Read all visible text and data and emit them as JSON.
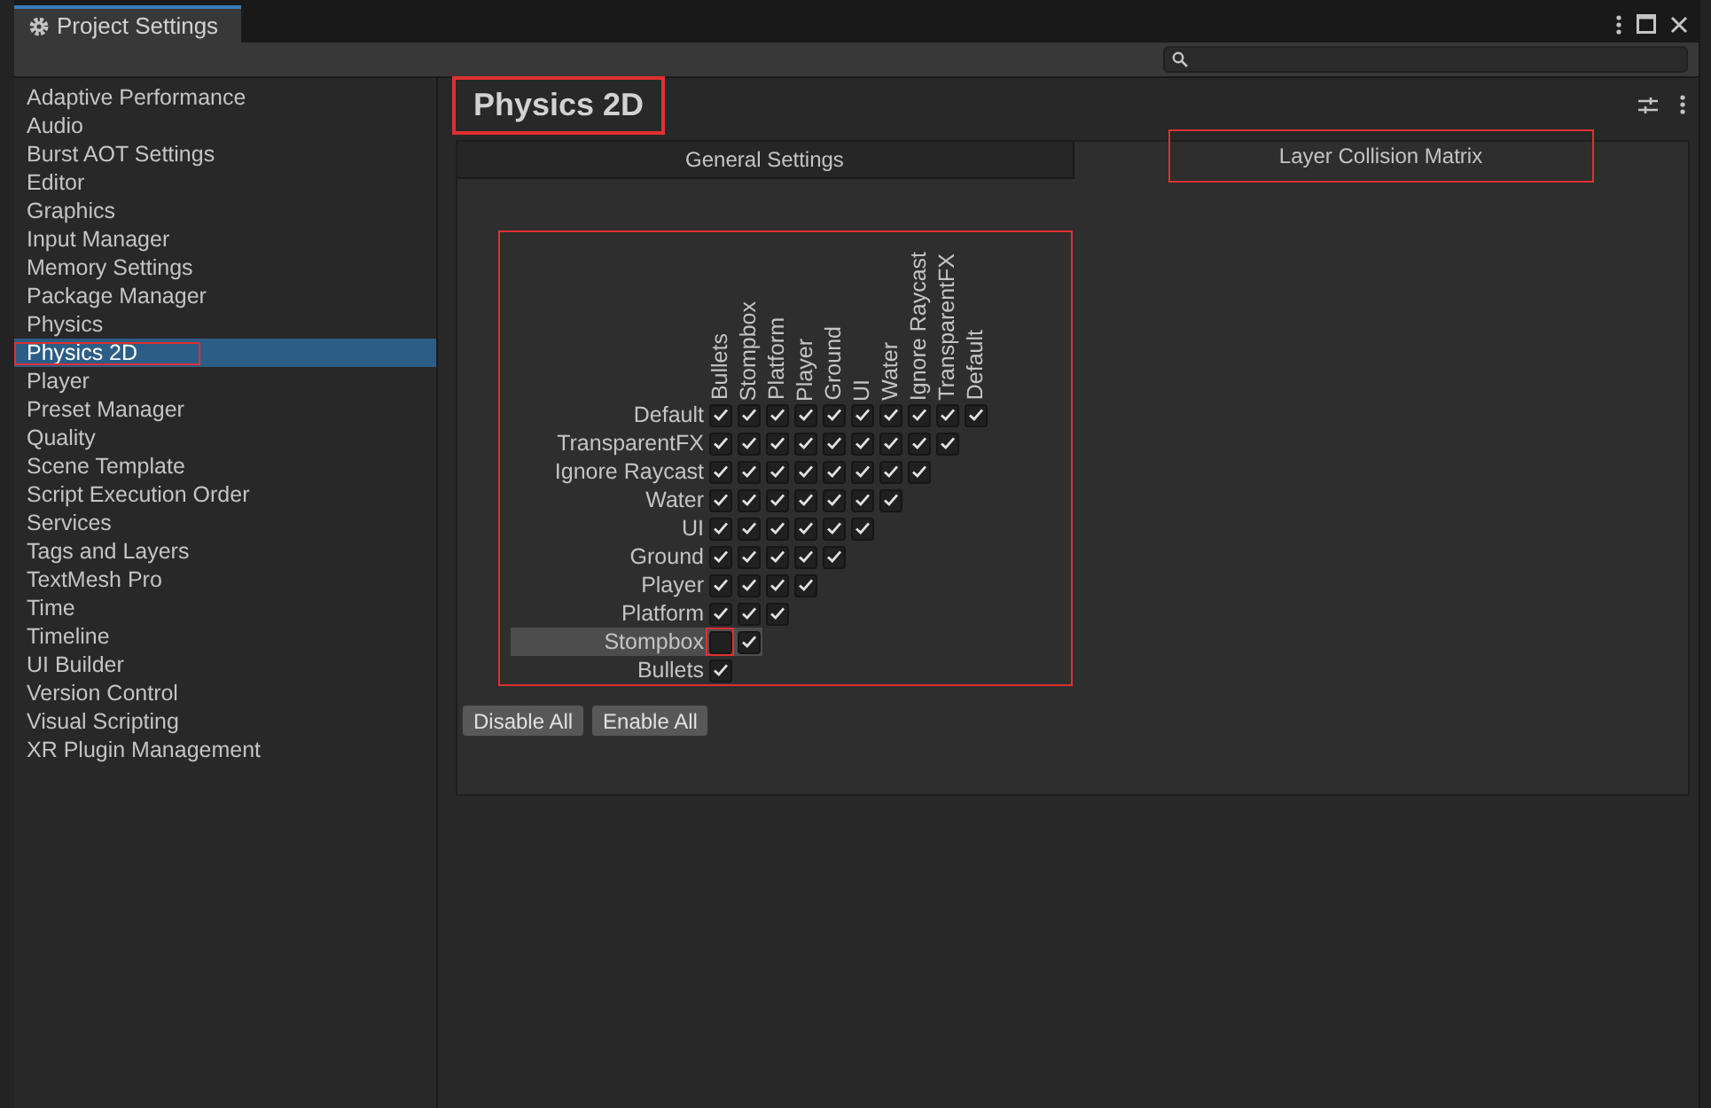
{
  "window": {
    "title": "Project Settings"
  },
  "sidebar": {
    "items": [
      {
        "label": "Adaptive Performance",
        "selected": false,
        "annotated": false
      },
      {
        "label": "Audio",
        "selected": false,
        "annotated": false
      },
      {
        "label": "Burst AOT Settings",
        "selected": false,
        "annotated": false
      },
      {
        "label": "Editor",
        "selected": false,
        "annotated": false
      },
      {
        "label": "Graphics",
        "selected": false,
        "annotated": false
      },
      {
        "label": "Input Manager",
        "selected": false,
        "annotated": false
      },
      {
        "label": "Memory Settings",
        "selected": false,
        "annotated": false
      },
      {
        "label": "Package Manager",
        "selected": false,
        "annotated": false
      },
      {
        "label": "Physics",
        "selected": false,
        "annotated": false
      },
      {
        "label": "Physics 2D",
        "selected": true,
        "annotated": true
      },
      {
        "label": "Player",
        "selected": false,
        "annotated": false
      },
      {
        "label": "Preset Manager",
        "selected": false,
        "annotated": false
      },
      {
        "label": "Quality",
        "selected": false,
        "annotated": false
      },
      {
        "label": "Scene Template",
        "selected": false,
        "annotated": false
      },
      {
        "label": "Script Execution Order",
        "selected": false,
        "annotated": false
      },
      {
        "label": "Services",
        "selected": false,
        "annotated": false
      },
      {
        "label": "Tags and Layers",
        "selected": false,
        "annotated": false
      },
      {
        "label": "TextMesh Pro",
        "selected": false,
        "annotated": false
      },
      {
        "label": "Time",
        "selected": false,
        "annotated": false
      },
      {
        "label": "Timeline",
        "selected": false,
        "annotated": false
      },
      {
        "label": "UI Builder",
        "selected": false,
        "annotated": false
      },
      {
        "label": "Version Control",
        "selected": false,
        "annotated": false
      },
      {
        "label": "Visual Scripting",
        "selected": false,
        "annotated": false
      },
      {
        "label": "XR Plugin Management",
        "selected": false,
        "annotated": false
      }
    ]
  },
  "page": {
    "title": "Physics 2D",
    "title_annotated": true
  },
  "tabs": [
    {
      "label": "General Settings",
      "selected": false,
      "annotated": false
    },
    {
      "label": "Layer Collision Matrix",
      "selected": true,
      "annotated": true
    }
  ],
  "matrix": {
    "annotated": true,
    "columns": [
      "Bullets",
      "Stompbox",
      "Platform",
      "Player",
      "Ground",
      "UI",
      "Water",
      "Ignore Raycast",
      "TransparentFX",
      "Default"
    ],
    "rows": [
      {
        "label": "Default",
        "highlighted": false,
        "first_cell_annotated": false,
        "cells": [
          {
            "checked": true
          },
          {
            "checked": true
          },
          {
            "checked": true
          },
          {
            "checked": true
          },
          {
            "checked": true
          },
          {
            "checked": true
          },
          {
            "checked": true
          },
          {
            "checked": true
          },
          {
            "checked": true
          },
          {
            "checked": true
          }
        ]
      },
      {
        "label": "TransparentFX",
        "highlighted": false,
        "first_cell_annotated": false,
        "cells": [
          {
            "checked": true
          },
          {
            "checked": true
          },
          {
            "checked": true
          },
          {
            "checked": true
          },
          {
            "checked": true
          },
          {
            "checked": true
          },
          {
            "checked": true
          },
          {
            "checked": true
          },
          {
            "checked": true
          }
        ]
      },
      {
        "label": "Ignore Raycast",
        "highlighted": false,
        "first_cell_annotated": false,
        "cells": [
          {
            "checked": true
          },
          {
            "checked": true
          },
          {
            "checked": true
          },
          {
            "checked": true
          },
          {
            "checked": true
          },
          {
            "checked": true
          },
          {
            "checked": true
          },
          {
            "checked": true
          }
        ]
      },
      {
        "label": "Water",
        "highlighted": false,
        "first_cell_annotated": false,
        "cells": [
          {
            "checked": true
          },
          {
            "checked": true
          },
          {
            "checked": true
          },
          {
            "checked": true
          },
          {
            "checked": true
          },
          {
            "checked": true
          },
          {
            "checked": true
          }
        ]
      },
      {
        "label": "UI",
        "highlighted": false,
        "first_cell_annotated": false,
        "cells": [
          {
            "checked": true
          },
          {
            "checked": true
          },
          {
            "checked": true
          },
          {
            "checked": true
          },
          {
            "checked": true
          },
          {
            "checked": true
          }
        ]
      },
      {
        "label": "Ground",
        "highlighted": false,
        "first_cell_annotated": false,
        "cells": [
          {
            "checked": true
          },
          {
            "checked": true
          },
          {
            "checked": true
          },
          {
            "checked": true
          },
          {
            "checked": true
          }
        ]
      },
      {
        "label": "Player",
        "highlighted": false,
        "first_cell_annotated": false,
        "cells": [
          {
            "checked": true
          },
          {
            "checked": true
          },
          {
            "checked": true
          },
          {
            "checked": true
          }
        ]
      },
      {
        "label": "Platform",
        "highlighted": false,
        "first_cell_annotated": false,
        "cells": [
          {
            "checked": true
          },
          {
            "checked": true
          },
          {
            "checked": true
          }
        ]
      },
      {
        "label": "Stompbox",
        "highlighted": true,
        "first_cell_annotated": true,
        "cells": [
          {
            "checked": false
          },
          {
            "checked": true
          }
        ]
      },
      {
        "label": "Bullets",
        "highlighted": false,
        "first_cell_annotated": false,
        "cells": [
          {
            "checked": true
          }
        ]
      }
    ]
  },
  "buttons": [
    "Disable All",
    "Enable All"
  ]
}
